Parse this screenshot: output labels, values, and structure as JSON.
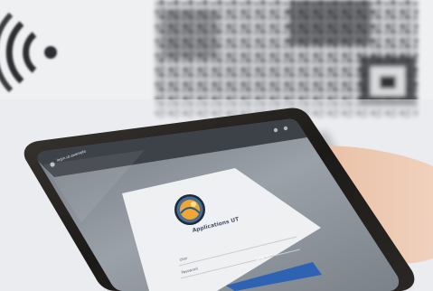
{
  "app": {
    "title": "Applications UT",
    "username_label": "User",
    "password_label": "Password",
    "login_button": "Log in",
    "url_text": "login.ut.example"
  },
  "colors": {
    "primary_blue": "#2e63b4",
    "background": "#eef0f2",
    "phone_bezel": "#1f1d1b",
    "screen_gray": "#8c939b",
    "card_white": "#f3f4f6",
    "skin": "#e9c3a9"
  },
  "icons": {
    "logo": "round-emblem-logo-icon",
    "wifi": "wifi-signal-icon",
    "qr": "blurred-qr-code-icon"
  }
}
